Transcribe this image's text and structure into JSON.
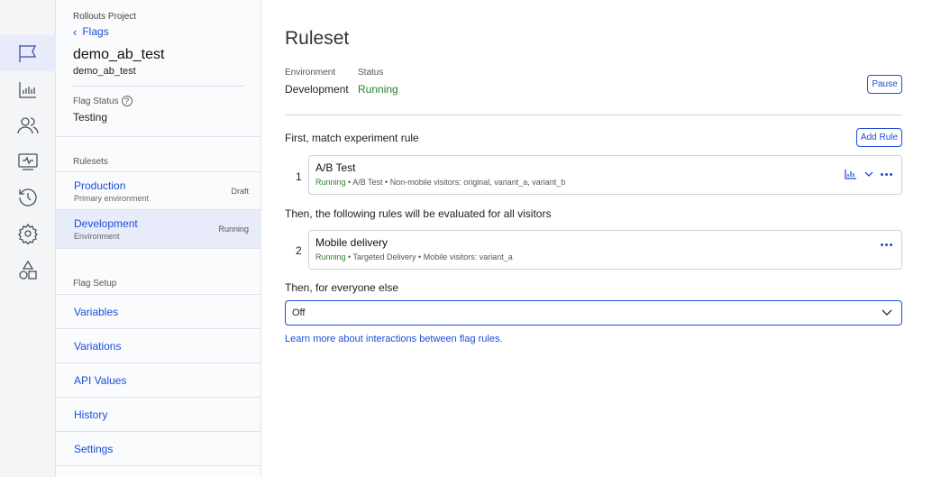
{
  "rail": {
    "items": [
      {
        "icon": "flag-icon",
        "active": true
      },
      {
        "icon": "bar-chart-icon"
      },
      {
        "icon": "users-icon"
      },
      {
        "icon": "monitor-pulse-icon"
      },
      {
        "icon": "history-icon"
      },
      {
        "icon": "gear-icon"
      },
      {
        "icon": "shapes-icon"
      }
    ]
  },
  "sidebar": {
    "project": "Rollouts Project",
    "back_label": "Flags",
    "flag_name": "demo_ab_test",
    "flag_key": "demo_ab_test",
    "flag_status_label": "Flag Status",
    "flag_status_value": "Testing",
    "rulesets_label": "Rulesets",
    "rulesets": [
      {
        "name": "Production",
        "sub": "Primary environment",
        "state": "Draft"
      },
      {
        "name": "Development",
        "sub": "Environment",
        "state": "Running",
        "active": true
      }
    ],
    "flag_setup_label": "Flag Setup",
    "setup_items": [
      "Variables",
      "Variations",
      "API Values",
      "History",
      "Settings"
    ]
  },
  "main": {
    "title": "Ruleset",
    "environment_label": "Environment",
    "environment_value": "Development",
    "status_label": "Status",
    "status_value": "Running",
    "pause_label": "Pause",
    "first_section": "First, match experiment rule",
    "add_rule_label": "Add Rule",
    "rules": [
      {
        "num": "1",
        "name": "A/B Test",
        "status": "Running",
        "meta": " • A/B Test • Non-mobile visitors: original, variant_a, variant_b"
      },
      {
        "num": "2",
        "name": "Mobile delivery",
        "status": "Running",
        "meta": " • Targeted Delivery • Mobile visitors: variant_a"
      }
    ],
    "then_section": "Then, the following rules will be evaluated for all visitors",
    "else_section": "Then, for everyone else",
    "else_value": "Off",
    "learn_more": "Learn more about interactions between flag rules."
  },
  "colors": {
    "accent": "#1d4ed8",
    "running": "#2e7d32",
    "active_bg": "#e8ecfa"
  }
}
